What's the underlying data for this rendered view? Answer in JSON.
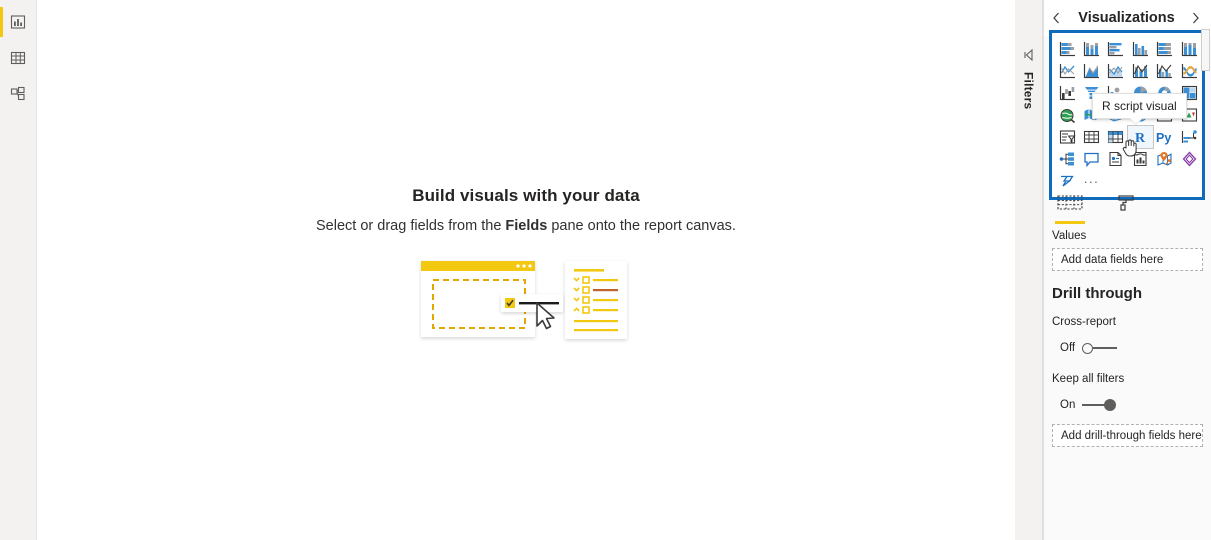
{
  "left_rail": {
    "items": [
      {
        "name": "report-view",
        "icon": "report-chart-icon",
        "active": true
      },
      {
        "name": "data-view",
        "icon": "table-grid-icon",
        "active": false
      },
      {
        "name": "model-view",
        "icon": "model-relationship-icon",
        "active": false
      }
    ]
  },
  "canvas": {
    "title": "Build visuals with your data",
    "subtitle_before": "Select or drag fields from the ",
    "subtitle_bold": "Fields",
    "subtitle_after": " pane onto the report canvas.",
    "illustration": "canvas-drag-fields-illustration"
  },
  "filters_pane": {
    "label": "Filters",
    "expand_icon": "filters-expand-caret-icon"
  },
  "visualizations": {
    "title": "Visualizations",
    "collapse_icon": "chevron-left-icon",
    "expand_icon": "chevron-right-icon",
    "gallery_highlight_color": "#0f6cbd",
    "tooltip": "R script visual",
    "icons": [
      {
        "id": "stacked-bar-chart",
        "label": "Stacked bar chart"
      },
      {
        "id": "stacked-column-chart",
        "label": "Stacked column chart"
      },
      {
        "id": "clustered-bar-chart",
        "label": "Clustered bar chart"
      },
      {
        "id": "clustered-column-chart",
        "label": "Clustered column chart"
      },
      {
        "id": "100-stacked-bar-chart",
        "label": "100% Stacked bar chart"
      },
      {
        "id": "100-stacked-column-chart",
        "label": "100% Stacked column chart"
      },
      {
        "id": "line-chart",
        "label": "Line chart"
      },
      {
        "id": "area-chart",
        "label": "Area chart"
      },
      {
        "id": "stacked-area-chart",
        "label": "Stacked area chart"
      },
      {
        "id": "line-and-stacked-column-chart",
        "label": "Line and stacked column chart"
      },
      {
        "id": "line-and-clustered-column-chart",
        "label": "Line and clustered column chart"
      },
      {
        "id": "ribbon-chart",
        "label": "Ribbon chart"
      },
      {
        "id": "waterfall-chart",
        "label": "Waterfall chart"
      },
      {
        "id": "funnel-chart",
        "label": "Funnel"
      },
      {
        "id": "scatter-chart",
        "label": "Scatter chart"
      },
      {
        "id": "pie-chart",
        "label": "Pie chart"
      },
      {
        "id": "donut-chart",
        "label": "Donut chart"
      },
      {
        "id": "treemap",
        "label": "Treemap"
      },
      {
        "id": "map",
        "label": "Map"
      },
      {
        "id": "filled-map",
        "label": "Filled map"
      },
      {
        "id": "shape-map",
        "label": "Shape map"
      },
      {
        "id": "azure-map",
        "label": "Azure map"
      },
      {
        "id": "gauge",
        "label": "Gauge"
      },
      {
        "id": "kpi",
        "label": "KPI"
      },
      {
        "id": "slicer",
        "label": "Slicer"
      },
      {
        "id": "table",
        "label": "Table"
      },
      {
        "id": "matrix",
        "label": "Matrix"
      },
      {
        "id": "r-script-visual",
        "label": "R script visual",
        "selected": true
      },
      {
        "id": "python-visual",
        "label": "Python visual"
      },
      {
        "id": "decomposition-tree",
        "label": "Decomposition tree"
      },
      {
        "id": "key-influencers",
        "label": "Key influencers"
      },
      {
        "id": "qna",
        "label": "Q&A"
      },
      {
        "id": "smart-narrative",
        "label": "Smart narrative"
      },
      {
        "id": "paginated-report",
        "label": "Paginated report"
      },
      {
        "id": "arcgis-map",
        "label": "ArcGIS Maps for Power BI"
      },
      {
        "id": "power-apps",
        "label": "Power Apps for Power BI"
      },
      {
        "id": "power-automate",
        "label": "Power Automate for Power BI"
      }
    ],
    "more_label": "...",
    "well_tabs": [
      {
        "id": "fields-tab",
        "icon": "fields-grid-icon",
        "active": true
      },
      {
        "id": "format-tab",
        "icon": "paint-roller-icon",
        "active": false
      }
    ],
    "values_label": "Values",
    "values_placeholder": "Add data fields here",
    "drill_through": {
      "heading": "Drill through",
      "cross_report_label": "Cross-report",
      "cross_report_state": "Off",
      "keep_all_filters_label": "Keep all filters",
      "keep_all_filters_state": "On",
      "drop_placeholder": "Add drill-through fields here"
    }
  }
}
